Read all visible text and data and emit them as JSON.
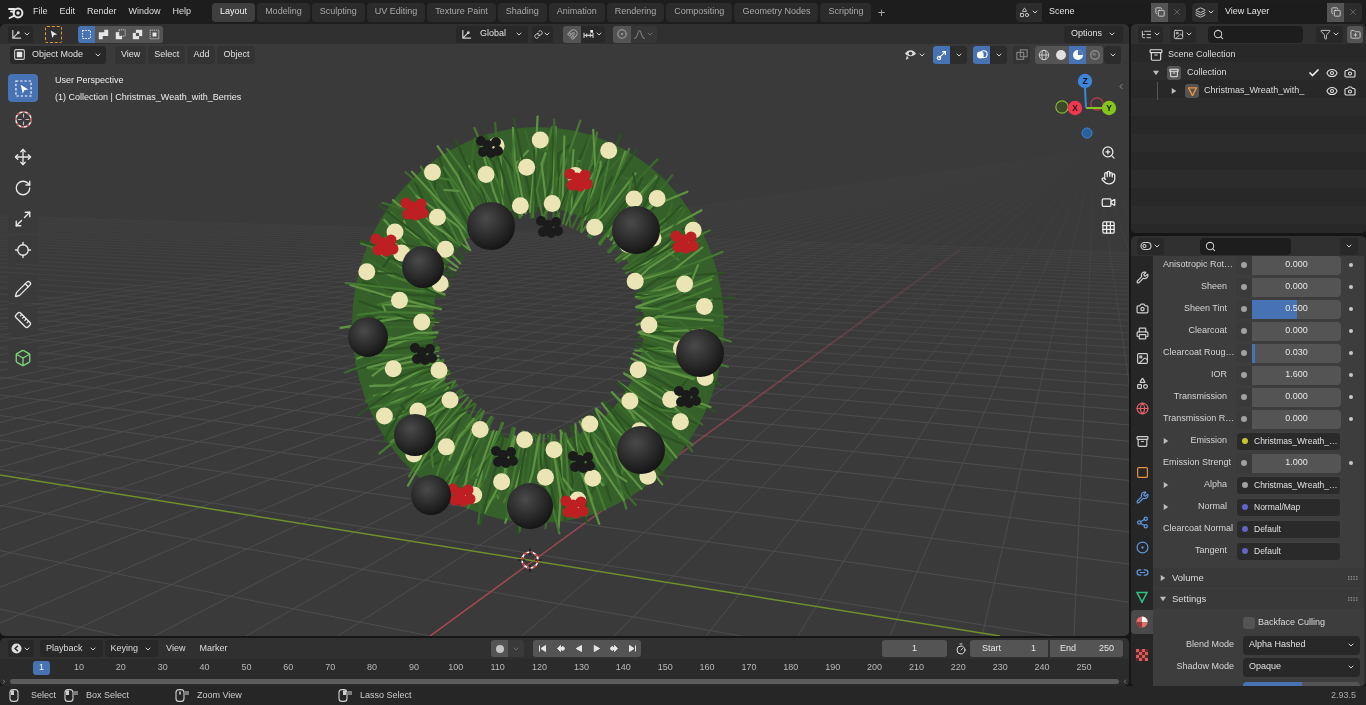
{
  "top_bar": {
    "menus": [
      "File",
      "Edit",
      "Render",
      "Window",
      "Help"
    ],
    "workspaces": [
      {
        "label": "Layout",
        "selected": true
      },
      {
        "label": "Modeling",
        "selected": false
      },
      {
        "label": "Sculpting",
        "selected": false
      },
      {
        "label": "UV Editing",
        "selected": false
      },
      {
        "label": "Texture Paint",
        "selected": false
      },
      {
        "label": "Shading",
        "selected": false
      },
      {
        "label": "Animation",
        "selected": false
      },
      {
        "label": "Rendering",
        "selected": false
      },
      {
        "label": "Compositing",
        "selected": false
      },
      {
        "label": "Geometry Nodes",
        "selected": false
      },
      {
        "label": "Scripting",
        "selected": false
      }
    ],
    "add_workspace": "+",
    "scene": "Scene",
    "view_layer": "View Layer"
  },
  "tool_header": {
    "select_modes": [
      {
        "kind": "set",
        "selected": true
      },
      {
        "kind": "extend",
        "selected": false
      },
      {
        "kind": "subtract",
        "selected": false
      },
      {
        "kind": "difference",
        "selected": false
      },
      {
        "kind": "intersect",
        "selected": false
      }
    ],
    "orientation": "Global",
    "options": "Options"
  },
  "viewport_header": {
    "mode": "Object Mode",
    "menus": [
      "View",
      "Select",
      "Add",
      "Object"
    ],
    "toggles": [
      {
        "kind": "gizmo",
        "on": true
      },
      {
        "kind": "overlay",
        "on": true
      },
      {
        "kind": "xray",
        "on": false
      }
    ],
    "shading_modes": [
      {
        "kind": "wireframe",
        "selected": false
      },
      {
        "kind": "solid",
        "selected": false
      },
      {
        "kind": "material",
        "selected": true
      },
      {
        "kind": "rendered",
        "selected": false
      }
    ]
  },
  "toolbar": [
    {
      "kind": "select_box",
      "selected": true
    },
    {
      "kind": "cursor",
      "selected": false
    },
    {
      "kind": "move",
      "selected": false
    },
    {
      "kind": "rotate",
      "selected": false
    },
    {
      "kind": "scale",
      "selected": false
    },
    {
      "kind": "transform",
      "selected": false
    },
    {
      "kind": "annotate",
      "selected": false
    },
    {
      "kind": "measure",
      "selected": false
    },
    {
      "kind": "add_cube",
      "selected": false
    }
  ],
  "viewport": {
    "view_name": "User Perspective",
    "object_info": "(1) Collection | Christmas_Weath_with_Berries",
    "axes": [
      {
        "label": "Z",
        "color": "#3b86dc"
      },
      {
        "label": "X",
        "color": "#f2384f"
      },
      {
        "label": "Y",
        "color": "#85c51c"
      }
    ]
  },
  "outliner": {
    "items": [
      {
        "kind": "scene_collection",
        "label": "Scene Collection",
        "children": [
          {
            "kind": "collection",
            "label": "Collection",
            "expanded": true,
            "checked": true,
            "children": [
              {
                "kind": "mesh_object",
                "label": "Christmas_Wreath_with_",
                "expanded": false
              }
            ]
          }
        ]
      }
    ]
  },
  "properties": {
    "tabs": [
      {
        "kind": "tool",
        "selected": false
      },
      {
        "kind": "render",
        "selected": false
      },
      {
        "kind": "output",
        "selected": false
      },
      {
        "kind": "view_layer",
        "selected": false
      },
      {
        "kind": "scene",
        "selected": false
      },
      {
        "kind": "world",
        "selected": false
      },
      {
        "kind": "collection",
        "selected": false
      },
      {
        "kind": "object",
        "selected": false
      },
      {
        "kind": "modifiers",
        "selected": false
      },
      {
        "kind": "particles",
        "selected": false
      },
      {
        "kind": "physics",
        "selected": false
      },
      {
        "kind": "constraints",
        "selected": false
      },
      {
        "kind": "data",
        "selected": false
      },
      {
        "kind": "material",
        "selected": true
      },
      {
        "kind": "texture",
        "selected": false
      }
    ],
    "inputs": [
      {
        "kind": "slider",
        "label": "Anisotropic Rot…",
        "value": "0.000",
        "level": 0,
        "color": "#a1a1a1"
      },
      {
        "kind": "slider",
        "label": "Sheen",
        "value": "0.000",
        "level": 0,
        "color": "#a1a1a1"
      },
      {
        "kind": "slider",
        "label": "Sheen Tint",
        "value": "0.500",
        "level": 0.5,
        "color": "#a1a1a1"
      },
      {
        "kind": "slider",
        "label": "Clearcoat",
        "value": "0.000",
        "level": 0,
        "color": "#a1a1a1"
      },
      {
        "kind": "slider",
        "label": "Clearcoat Roug…",
        "value": "0.030",
        "level": 0.03,
        "color": "#a1a1a1"
      },
      {
        "kind": "number",
        "label": "IOR",
        "value": "1.600",
        "color": "#a1a1a1"
      },
      {
        "kind": "slider",
        "label": "Transmission",
        "value": "0.000",
        "level": 0,
        "color": "#a1a1a1"
      },
      {
        "kind": "slider",
        "label": "Transmission R…",
        "value": "0.000",
        "level": 0,
        "color": "#a1a1a1"
      },
      {
        "kind": "link",
        "label": "Emission",
        "value": "Christmas_Wreath_…",
        "color": "#c7c729"
      },
      {
        "kind": "number",
        "label": "Emission Strengt",
        "value": "1.000",
        "color": "#a1a1a1"
      },
      {
        "kind": "link",
        "label": "Alpha",
        "value": "Christmas_Wreath_…",
        "color": "#a1a1a1"
      },
      {
        "kind": "link",
        "label": "Normal",
        "value": "Normal/Map",
        "color": "#6363c7"
      },
      {
        "kind": "socket",
        "label": "Clearcoat Normal",
        "value": "Default",
        "color": "#6363c7"
      },
      {
        "kind": "socket",
        "label": "Tangent",
        "value": "Default",
        "color": "#6363c7"
      }
    ],
    "panels": [
      {
        "title": "Volume",
        "expanded": false
      },
      {
        "title": "Settings",
        "expanded": true,
        "fields": [
          {
            "kind": "checkbox",
            "label": "Backface Culling",
            "checked": false
          },
          {
            "kind": "dropdown",
            "label": "Blend Mode",
            "value": "Alpha Hashed"
          },
          {
            "kind": "dropdown",
            "label": "Shadow Mode",
            "value": "Opaque"
          },
          {
            "kind": "slider",
            "level": 0.5
          }
        ]
      }
    ]
  },
  "timeline": {
    "menus": [
      {
        "kind": "dropdown",
        "label": "Playback"
      },
      {
        "kind": "dropdown",
        "label": "Keying"
      },
      {
        "kind": "menu",
        "label": "View"
      },
      {
        "kind": "menu",
        "label": "Marker"
      }
    ],
    "auto_keying": false,
    "current_frame": "1",
    "start_label": "Start",
    "start": "1",
    "end_label": "End",
    "end": "250",
    "playhead": "1",
    "ruler_labels": [
      "10",
      "20",
      "30",
      "40",
      "50",
      "60",
      "70",
      "80",
      "90",
      "100",
      "110",
      "120",
      "130",
      "140",
      "150",
      "160",
      "170",
      "180",
      "190",
      "200",
      "210",
      "220",
      "230",
      "240",
      "250"
    ]
  },
  "status_bar": {
    "hints": [
      {
        "kind": "left_click",
        "label": "Select"
      },
      {
        "kind": "left_drag",
        "label": "Box Select"
      },
      {
        "kind": "middle_drag",
        "label": "Zoom View"
      },
      {
        "kind": "right_drag",
        "label": "Lasso Select"
      }
    ],
    "version": "2.93.5"
  }
}
